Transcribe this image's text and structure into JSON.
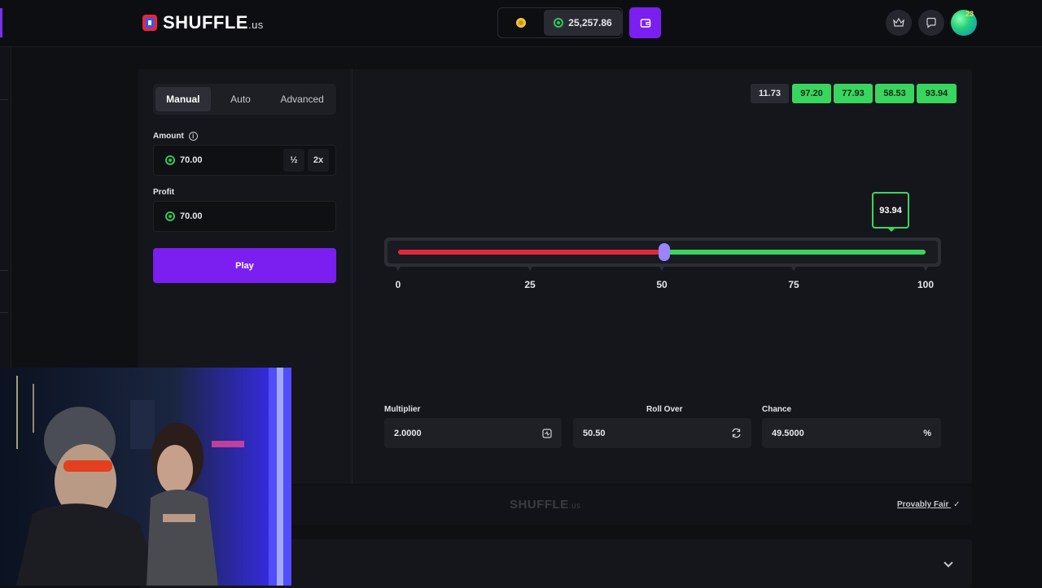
{
  "brand": {
    "name": "SHUFFLE",
    "tld": ".us"
  },
  "header": {
    "balance": "25,257.86",
    "avatar_badge": "23"
  },
  "bet_panel": {
    "tabs": [
      {
        "label": "Manual",
        "active": true
      },
      {
        "label": "Auto",
        "active": false
      },
      {
        "label": "Advanced",
        "active": false
      }
    ],
    "amount_label": "Amount",
    "amount_value": "70.00",
    "half_label": "½",
    "double_label": "2x",
    "profit_label": "Profit",
    "profit_value": "70.00",
    "play_label": "Play"
  },
  "history": [
    {
      "value": "11.73",
      "win": false
    },
    {
      "value": "97.20",
      "win": true
    },
    {
      "value": "77.93",
      "win": true
    },
    {
      "value": "58.53",
      "win": true
    },
    {
      "value": "93.94",
      "win": true
    }
  ],
  "dice": {
    "result": "93.94",
    "roll_over": 50.5,
    "ticks": [
      "0",
      "25",
      "50",
      "75",
      "100"
    ],
    "colors": {
      "lose": "#e0283d",
      "win": "#39d65f",
      "thumb": "#9a84ff",
      "accent": "#7a1ff0"
    }
  },
  "stats": {
    "multiplier_label": "Multiplier",
    "multiplier_value": "2.0000",
    "roll_over_label": "Roll Over",
    "roll_over_value": "50.50",
    "chance_label": "Chance",
    "chance_value": "49.5000",
    "chance_unit": "%"
  },
  "footer": {
    "logo": "SHUFFLE",
    "logo_tld": ".us",
    "provably_fair": "Provably Fair"
  }
}
